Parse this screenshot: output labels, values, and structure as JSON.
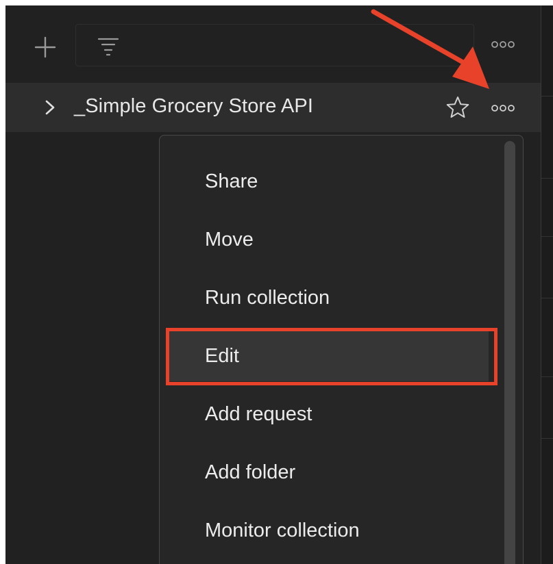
{
  "toolbar": {
    "add_icon": "plus-icon",
    "filter_icon": "filter-icon",
    "more_icon": "more-horizontal-icon"
  },
  "collection": {
    "name": "_Simple Grocery Store API",
    "chevron_icon": "chevron-right-icon",
    "star_icon": "star-outline-icon",
    "more_icon": "more-horizontal-icon"
  },
  "menu": {
    "items": [
      {
        "label": "Share"
      },
      {
        "label": "Move"
      },
      {
        "label": "Run collection"
      },
      {
        "label": "Edit",
        "active": true
      },
      {
        "label": "Add request"
      },
      {
        "label": "Add folder"
      },
      {
        "label": "Monitor collection"
      }
    ]
  },
  "annotation": {
    "color": "#e8432a"
  }
}
